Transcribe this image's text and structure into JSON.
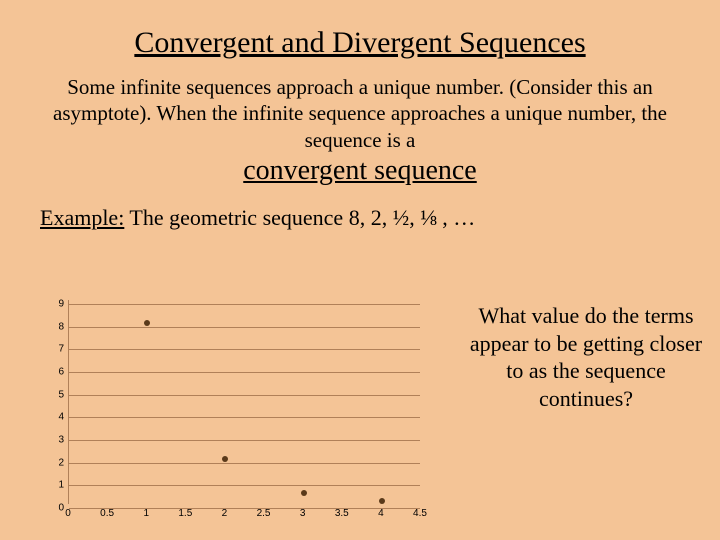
{
  "title": "Convergent and Divergent Sequences",
  "intro": "Some infinite sequences approach a unique number.  (Consider this an asymptote).  When the infinite sequence approaches a unique number, the sequence is a",
  "term": "convergent sequence",
  "example_label": "Example:",
  "example_text": "  The geometric sequence  8, 2, ½, ⅛ , …",
  "question": "What value do the terms appear to be getting closer to as the sequence continues?",
  "chart_data": {
    "type": "scatter",
    "x": [
      1,
      2,
      3,
      4
    ],
    "y": [
      8,
      2,
      0.5,
      0.125
    ],
    "title": "",
    "xlabel": "",
    "ylabel": "",
    "xlim": [
      0,
      4.5
    ],
    "ylim": [
      0,
      9
    ],
    "xticks": [
      0,
      0.5,
      1,
      1.5,
      2,
      2.5,
      3,
      3.5,
      4,
      4.5
    ],
    "yticks": [
      0,
      1,
      2,
      3,
      4,
      5,
      6,
      7,
      8,
      9
    ],
    "grid": "horizontal"
  }
}
